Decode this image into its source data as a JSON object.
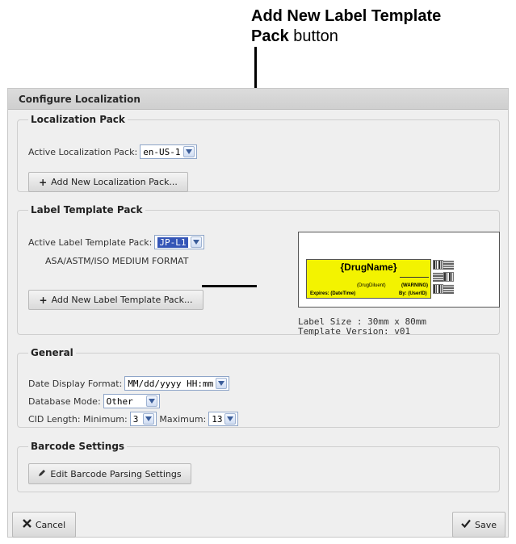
{
  "callout": {
    "title": "Add New Label Template",
    "title_bold_part2": "Pack",
    "title_suffix": " button"
  },
  "dialog": {
    "title": "Configure Localization",
    "localization": {
      "legend": "Localization Pack",
      "active_label": "Active Localization Pack:",
      "active_value": "en-US-1",
      "add_button": "Add New Localization Pack..."
    },
    "label_template": {
      "legend": "Label Template Pack",
      "active_label": "Active Label Template Pack:",
      "active_value": "JP-L1",
      "format_text": "ASA/ASTM/ISO MEDIUM FORMAT",
      "add_button": "Add New Label Template Pack...",
      "preview": {
        "drug_name": "{DrugName}",
        "drug_diluent": "(DrugDiluent)",
        "warning": "(WARNING)",
        "expires": "Expires: (DateTime)",
        "by": "By: (UserID)"
      },
      "label_size": "Label Size : 30mm x 80mm",
      "template_version": "Template Version: v01"
    },
    "general": {
      "legend": "General",
      "date_format_label": "Date Display Format:",
      "date_format_value": "MM/dd/yyyy HH:mm",
      "db_mode_label": "Database Mode:",
      "db_mode_value": "Other",
      "cid_label": "CID Length: Minimum:",
      "cid_min": "3",
      "cid_max_label": "Maximum:",
      "cid_max": "13"
    },
    "barcode": {
      "legend": "Barcode Settings",
      "edit_button": "Edit Barcode Parsing Settings"
    },
    "cancel_button": "Cancel",
    "save_button": "Save"
  },
  "colors": {
    "label_yellow": "#f3f300",
    "selection_blue": "#3556b7"
  },
  "icons": {
    "add": "plus-icon",
    "edit": "pencil-icon",
    "cancel": "x-icon",
    "save": "checkmark-icon",
    "dropdown": "chevron-down-icon"
  }
}
